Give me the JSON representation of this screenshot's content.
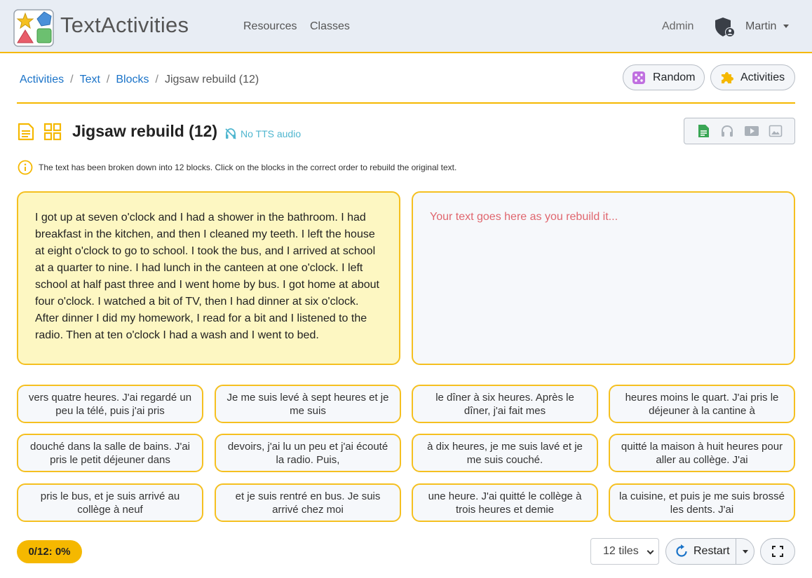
{
  "navbar": {
    "brand": "TextActivities",
    "links": [
      "Resources",
      "Classes"
    ],
    "admin": "Admin",
    "user": "Martin"
  },
  "breadcrumb": {
    "items": [
      "Activities",
      "Text",
      "Blocks"
    ],
    "current": "Jigsaw rebuild (12)"
  },
  "buttons": {
    "random": "Random",
    "activities": "Activities"
  },
  "activity": {
    "title": "Jigsaw rebuild (12)",
    "tts_status": "No TTS audio",
    "instructions": "The text has been broken down into 12 blocks. Click on the blocks in the correct order to rebuild the original text.",
    "source_text": "I got up at seven o'clock and I had a shower in the bathroom. I had breakfast in the kitchen, and then I cleaned my teeth. I left the house at eight o'clock to go to school. I took the bus, and I arrived at school at a quarter to nine. I had lunch in the canteen at one o'clock. I left school at half past three and I went home by bus. I got home at about four o'clock. I watched a bit of TV, then I had dinner at six o'clock. After dinner I did my homework, I read for a bit and I listened to the radio. Then at ten o'clock I had a wash and I went to bed.",
    "target_placeholder": "Your text goes here as you rebuild it..."
  },
  "tiles": [
    "vers quatre heures. J'ai regardé un peu la télé, puis j'ai pris",
    "Je me suis levé à sept heures et je me suis",
    "le dîner à six heures. Après le dîner, j'ai fait mes",
    "heures moins le quart. J'ai pris le déjeuner à la cantine à",
    "douché dans la salle de bains. J'ai pris le petit déjeuner dans",
    "devoirs, j'ai lu un peu et j'ai écouté la radio. Puis,",
    "à dix heures, je me suis lavé et je me suis couché.",
    "quitté la maison à huit heures pour aller au collège. J'ai",
    "pris le bus, et je suis arrivé au collège à neuf",
    "et je suis rentré en bus. Je suis arrivé chez moi",
    "une heure. J'ai quitté le collège à trois heures et demie",
    "la cuisine, et puis je me suis brossé les dents. J'ai"
  ],
  "footer": {
    "score": "0/12: 0%",
    "tiles_select": "12 tiles",
    "restart": "Restart"
  },
  "colors": {
    "accent": "#f5b800",
    "link": "#1a73c8",
    "source_bg": "#fdf7c2",
    "placeholder": "#e0666e"
  }
}
